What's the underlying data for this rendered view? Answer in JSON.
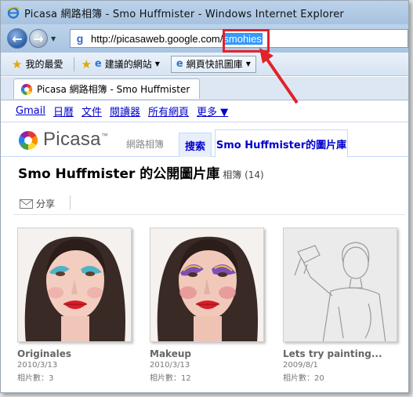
{
  "window": {
    "title": "Picasa 網路相簿 - Smo Huffmister - Windows Internet Explorer"
  },
  "address": {
    "url_base": "http://picasaweb.google.com/",
    "url_selected": "smohies"
  },
  "favorites": {
    "favorites_label": "我的最愛",
    "suggested_sites_label": "建議的網站",
    "web_slice_label": "網頁快訊圖庫"
  },
  "tab": {
    "label": "Picasa 網路相簿 - Smo Huffmister"
  },
  "google_bar": {
    "links": [
      "Gmail",
      "日曆",
      "文件",
      "閱讀器",
      "所有網頁",
      "更多 ▼"
    ]
  },
  "picasa": {
    "logo_text": "Picasa",
    "logo_tm": "™",
    "subtitle": "網路相簿",
    "search_tab": "搜索",
    "gallery_tab": "Smo Huffmister的圖片庫"
  },
  "gallery": {
    "title": "Smo Huffmister 的公開圖片庫",
    "subtitle": "相簿 (14)",
    "share_label": "分享"
  },
  "albums": [
    {
      "name": "Originales",
      "date": "2010/3/13",
      "count": "相片數：3"
    },
    {
      "name": "Makeup",
      "date": "2010/3/13",
      "count": "相片數：12"
    },
    {
      "name": "Lets try painting...",
      "date": "2009/8/1",
      "count": "相片數：20"
    }
  ],
  "colors": {
    "link": "#0000cc",
    "highlight": "#e0222b",
    "selection": "#3399ff"
  }
}
